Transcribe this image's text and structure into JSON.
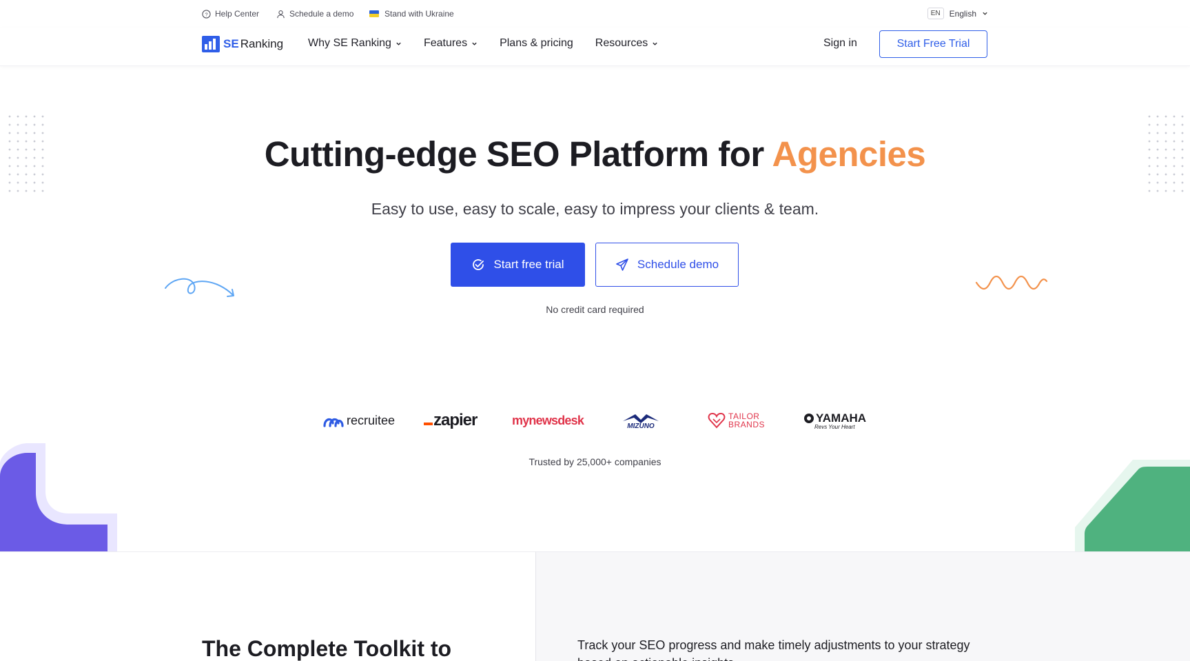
{
  "utility": {
    "help_center": "Help Center",
    "schedule_demo": "Schedule a demo",
    "ukraine": "Stand with Ukraine",
    "lang_code": "EN",
    "lang_label": "English"
  },
  "nav": {
    "logo_se": "SE",
    "logo_ranking": "Ranking",
    "links": [
      {
        "label": "Why SE Ranking"
      },
      {
        "label": "Features"
      },
      {
        "label": "Plans & pricing"
      },
      {
        "label": "Resources"
      }
    ],
    "sign_in": "Sign in",
    "start_trial": "Start Free Trial"
  },
  "hero": {
    "title_main": "Cutting-edge SEO Platform for ",
    "title_accent": "Agencies",
    "subtitle": "Easy to use, easy to scale, easy to impress your clients & team.",
    "primary_cta": "Start free trial",
    "secondary_cta": "Schedule demo",
    "note": "No credit card required"
  },
  "logos": {
    "brands": [
      "recruitee",
      "zapier",
      "mynewsdesk",
      "MIZUNO",
      "TAILOR BRANDS",
      "YAMAHA"
    ],
    "yamaha_tagline": "Revs Your Heart",
    "trusted": "Trusted by 25,000+ companies"
  },
  "bottom": {
    "toolkit_title": "The Complete Toolkit to",
    "track_text": "Track your SEO progress and make timely adjustments to your strategy based on actionable insights"
  },
  "colors": {
    "brand_blue": "#2f5ee8",
    "cta_blue": "#2f4fe8",
    "accent_orange": "#f3924c"
  }
}
